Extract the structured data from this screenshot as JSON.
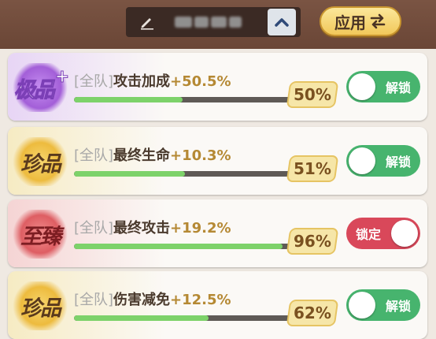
{
  "header": {
    "apply_label": "应用",
    "icons": {
      "edit": "pencil-icon",
      "collapse": "chevron-up-icon",
      "apply": "swap-arrows-icon"
    }
  },
  "colors": {
    "toggle_on": "#47b46e",
    "toggle_locked": "#d9485a",
    "progress_fill": "#7dd26a",
    "bonus_text": "#b58934"
  },
  "entries": [
    {
      "rarity": "极品",
      "rarity_plus": "+",
      "tier": "purple",
      "team": "[全队]",
      "stat": "攻击加成",
      "bonus": "+50.5%",
      "percent_label": "50%",
      "progress": 0.5,
      "toggle_label": "解锁",
      "locked": false
    },
    {
      "rarity": "珍品",
      "rarity_plus": "",
      "tier": "gold",
      "team": "[全队]",
      "stat": "最终生命",
      "bonus": "+10.3%",
      "percent_label": "51%",
      "progress": 0.51,
      "toggle_label": "解锁",
      "locked": false
    },
    {
      "rarity": "至臻",
      "rarity_plus": "",
      "tier": "red",
      "team": "[全队]",
      "stat": "最终攻击",
      "bonus": "+19.2%",
      "percent_label": "96%",
      "progress": 0.96,
      "toggle_label": "锁定",
      "locked": true
    },
    {
      "rarity": "珍品",
      "rarity_plus": "",
      "tier": "gold",
      "team": "[全队]",
      "stat": "伤害减免",
      "bonus": "+12.5%",
      "percent_label": "62%",
      "progress": 0.62,
      "toggle_label": "解锁",
      "locked": false
    }
  ]
}
